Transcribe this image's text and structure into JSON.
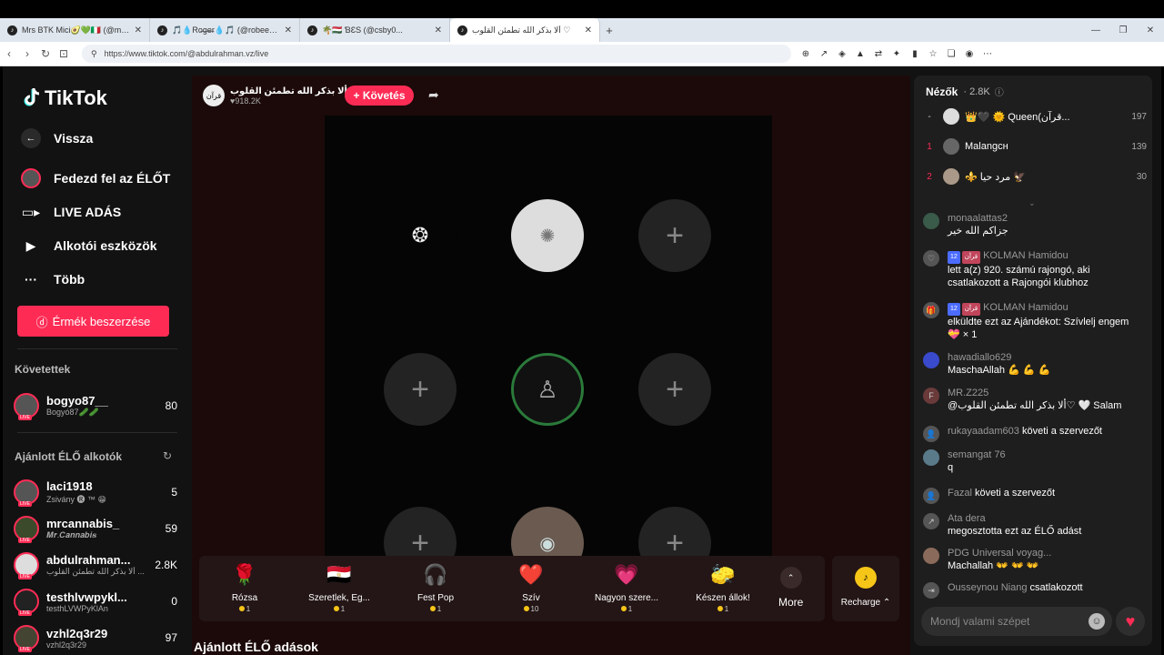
{
  "browser": {
    "tabs": [
      {
        "title": "Mrs BTK Mici🥑💚🇮🇹 (@mrsbtk) É...",
        "active": false
      },
      {
        "title": "🎵💧Ro̶g̶e̶r💧🎵 (@robee_89) ÉLŐ a...",
        "active": false
      },
      {
        "title": "🌴🇭🇺 ƁƐS (@csby0...",
        "active": false
      },
      {
        "title": "ألا بذكر الله تطمئن القلوب ♡",
        "active": true
      }
    ],
    "url": "https://www.tiktok.com/@abdulrahman.vz/live"
  },
  "sidebar": {
    "logo": "TikTok",
    "nav": [
      {
        "label": "Vissza",
        "icon": "back-arrow-icon"
      },
      {
        "label": "Fedezd fel az ÉLŐT",
        "icon": "avatar-icon"
      },
      {
        "label": "LIVE ADÁS",
        "icon": "camera-icon"
      },
      {
        "label": "Alkotói eszközök",
        "icon": "creator-tools-icon"
      },
      {
        "label": "Több",
        "icon": "more-dots-icon"
      }
    ],
    "coin_button": "Érmék beszerzése",
    "following_title": "Követettek",
    "following": [
      {
        "name": "bogyo87__",
        "sub": "Bogyó87🥒🥒",
        "count": "80"
      }
    ],
    "recommended_title": "Ajánlott ÉLŐ alkotók",
    "recommended": [
      {
        "name": "laci1918",
        "sub": "Zsivány 🅡 ™ 😁",
        "count": "5"
      },
      {
        "name": "mrcannabis_",
        "sub": "𝑴𝒓.𝑪𝒂𝒏𝒏𝒂𝒃𝒊𝒔",
        "count": "59"
      },
      {
        "name": "abdulrahman...",
        "sub": "ألا بذكر الله تطمئن القلوب ...",
        "count": "2.8K"
      },
      {
        "name": "testhlvwpykl...",
        "sub": "testhLVWPyKlAn",
        "count": "0"
      },
      {
        "name": "vzhl2q3r29",
        "sub": "vzhl2q3r29",
        "count": "97"
      }
    ],
    "live_tag": "LIVE"
  },
  "stream": {
    "host_name": "ألا بذكر الله تطمئن القلوب ♥",
    "host_likes": "♥918.2K",
    "follow_label": "+ Követés",
    "host_avatar_text": "قرآن"
  },
  "gifts": [
    {
      "name": "Rózsa",
      "cost": "1",
      "icon": "🌹"
    },
    {
      "name": "Szeretlek, Eg...",
      "cost": "1",
      "icon": "🇪🇬"
    },
    {
      "name": "Fest Pop",
      "cost": "1",
      "icon": "🎧"
    },
    {
      "name": "Szív",
      "cost": "10",
      "icon": "❤️"
    },
    {
      "name": "Nagyon szere...",
      "cost": "1",
      "icon": "💗"
    },
    {
      "name": "Készen állok!",
      "cost": "1",
      "icon": "🧽"
    }
  ],
  "more_label": "More",
  "recharge_label": "Recharge ⌃",
  "recommended_live_title": "Ajánlott ÉLŐ adások",
  "viewers": {
    "title": "Nézők",
    "count": "· 2.8K",
    "list": [
      {
        "rank": "-",
        "name": "👑🖤 🌞 Queen(قرآن...",
        "score": "197"
      },
      {
        "rank": "1",
        "name": "Malangсн",
        "score": "139"
      },
      {
        "rank": "2",
        "name": "⚜️ مرد حيا 🦅",
        "score": "30"
      }
    ]
  },
  "chat": {
    "messages": [
      {
        "user": "monaalattas2",
        "text": "جزاكم الله خير"
      },
      {
        "user": "KOLMAN Hamidou",
        "badge": "12",
        "badge2": "قرآن",
        "text": "lett a(z) 920. számú rajongó, aki csatlakozott a Rajongói klubhoz"
      },
      {
        "user": "KOLMAN Hamidou",
        "badge": "12",
        "badge2": "قرآن",
        "text": "elküldte ezt az Ajándékot: Szívlelj engem 💝 × 1"
      },
      {
        "user": "hawadiallo629",
        "text": "MaschaAllah 💪 💪 💪"
      },
      {
        "user": "MR.Z225",
        "text": "@ألا بذكر الله تطمئن القلوب♡ 🤍 Salam"
      },
      {
        "user": "rukayaadam603",
        "text": "követi a szervezőt"
      },
      {
        "user": "semangat 76",
        "text": "q"
      },
      {
        "user": "Fazal",
        "text": "követi a szervezőt"
      },
      {
        "user": "Ata dera",
        "text": "megosztotta ezt az ÉLŐ adást"
      },
      {
        "user": "PDG Universal voyag...",
        "text": "Machallah 👐 👐 👐"
      },
      {
        "user": "Ousseynou Niang",
        "text": "csatlakozott"
      }
    ],
    "input_placeholder": "Mondj valami szépet"
  }
}
